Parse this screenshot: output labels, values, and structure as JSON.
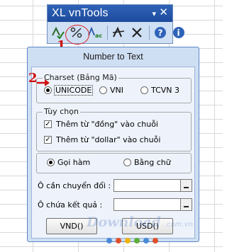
{
  "toolbar": {
    "title": "XL vnTools",
    "dropdown_glyph": "▾",
    "close_glyph": "✕",
    "icons": [
      "spellcheck-icon",
      "percent-convert-icon",
      "case-convert-icon",
      "text-format-icon",
      "delete-icon",
      "help-icon",
      "info-icon"
    ]
  },
  "annotations": {
    "step1": "1",
    "step2": "2"
  },
  "dialog": {
    "title": "Number to Text",
    "charset": {
      "label": "Charset (Bảng Mã)",
      "options": [
        "UNICODE",
        "VNI",
        "TCVN 3"
      ],
      "selected": "UNICODE"
    },
    "options_group": {
      "label": "Tùy chọn",
      "items": [
        {
          "label": "Thêm từ \"đồng\" vào chuỗi",
          "checked": true
        },
        {
          "label": "Thêm từ \"dollar\" vào chuỗi",
          "checked": true
        }
      ]
    },
    "mode": {
      "options": [
        "Gọi hàm",
        "Bằng chữ"
      ],
      "selected": "Gọi hàm"
    },
    "fields": {
      "source_label": "Ô cần chuyển đổi :",
      "result_label": "Ô chứa kết quả :"
    },
    "buttons": {
      "vnd": "VND()",
      "usd": "USD()"
    }
  },
  "watermark": {
    "text": "Download",
    "suffix": ".com.vn"
  },
  "colors": {
    "accent": "#2f63b8",
    "annotation": "#d01010"
  }
}
